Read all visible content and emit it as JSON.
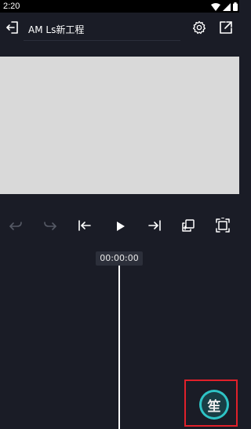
{
  "status_bar": {
    "time": "2:20",
    "icons": [
      "wifi-icon",
      "signal-icon",
      "battery-icon"
    ]
  },
  "app_bar": {
    "back_icon": "exit-icon",
    "project_title": "AM Ls新工程",
    "settings_icon": "gear-icon",
    "export_icon": "export-icon"
  },
  "playback_controls": {
    "buttons": [
      "undo-icon",
      "redo-icon",
      "skip-to-start-icon",
      "play-icon",
      "skip-to-end-icon",
      "copy-icon",
      "fullscreen-icon"
    ]
  },
  "timeline": {
    "timecode": "00:00:00"
  },
  "floating_button": {
    "label": "笙"
  },
  "colors": {
    "background": "#1a1c26",
    "preview": "#d9d9d9",
    "accent": "#2ec3c5",
    "highlight": "#e0202a",
    "disabled_icon": "#565a66"
  }
}
